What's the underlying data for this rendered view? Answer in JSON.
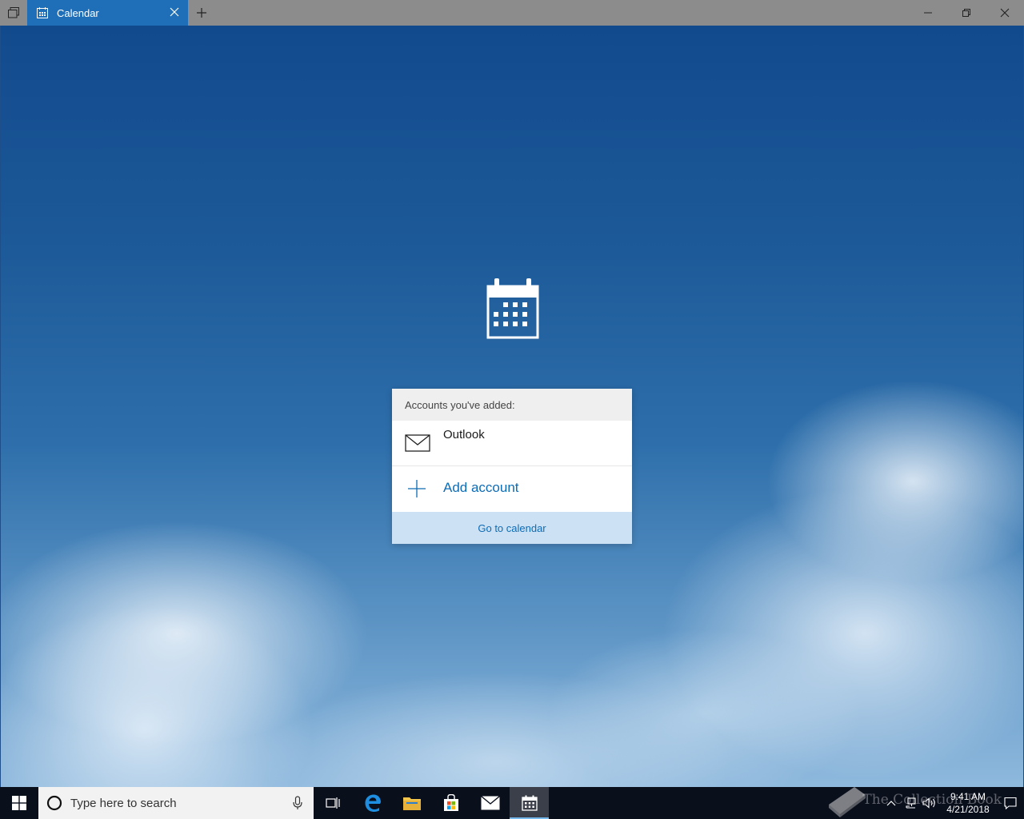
{
  "titlebar": {
    "tab_label": "Calendar"
  },
  "card": {
    "header": "Accounts you've added:",
    "accounts": [
      {
        "name": "Outlook",
        "icon": "mail-icon"
      }
    ],
    "add_account_label": "Add account",
    "go_to_calendar_label": "Go to calendar"
  },
  "taskbar": {
    "search_placeholder": "Type here to search",
    "time": "9:41 AM",
    "date": "4/21/2018",
    "watermark": "The Collection Book"
  },
  "colors": {
    "accent": "#0e6cb5",
    "tab_active": "#1e6fb8",
    "go_to_bg": "#cce1f3"
  }
}
